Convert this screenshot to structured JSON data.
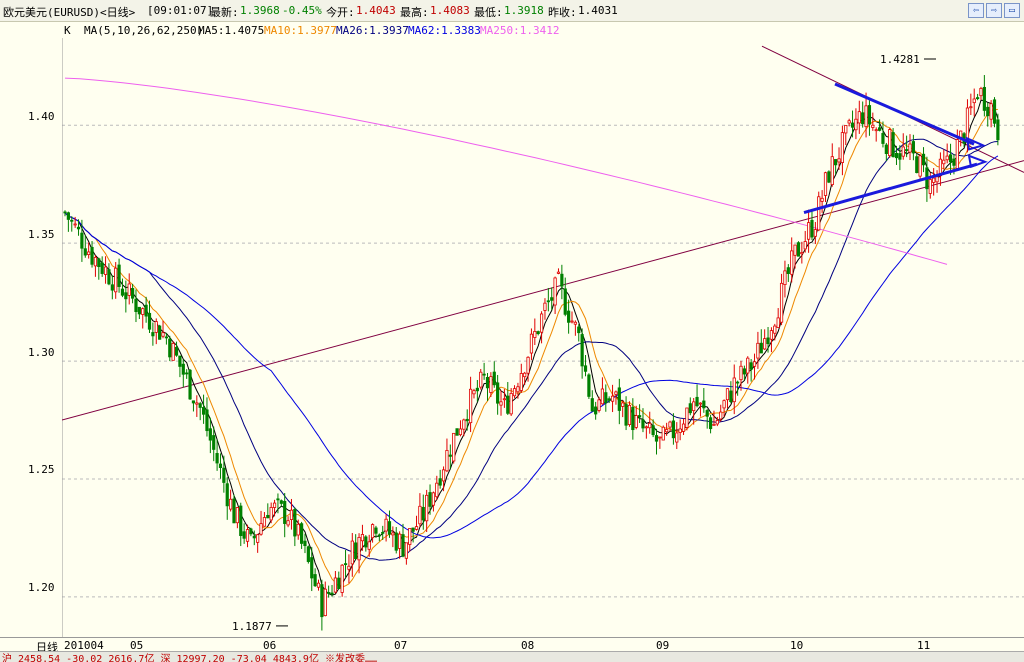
{
  "titlebar": {
    "instrument": "欧元美元(EURUSD)<日线>",
    "time": "[09:01:07]",
    "latest_label": "最新:",
    "latest": "1.3968",
    "change": "-0.45%",
    "open_label": "今开:",
    "open": "1.4043",
    "high_label": "最高:",
    "high": "1.4083",
    "low_label": "最低:",
    "low": "1.3918",
    "prev_label": "昨收:",
    "prev": "1.4031"
  },
  "ma_legend": {
    "k": "K",
    "params": "MA(5,10,26,62,250)",
    "ma5": "MA5:1.4075",
    "ma10": "MA10:1.3977",
    "ma26": "MA26:1.3937",
    "ma62": "MA62:1.3383",
    "ma250": "MA250:1.3412"
  },
  "colors": {
    "up": "#e00000",
    "down": "#008000",
    "ma5": "#000000",
    "ma10": "#ee8800",
    "ma26": "#000080",
    "ma62": "#0000e0",
    "ma250": "#ee60ee",
    "trend": "#800040",
    "arrow": "#1a1adc"
  },
  "x_axis": {
    "period": "日线",
    "labels": [
      "201004",
      "05",
      "06",
      "07",
      "08",
      "09",
      "10",
      "11"
    ]
  },
  "statusbar": {
    "text": "沪 2458.54  -30.02 2616.7亿  深 12997.20  -73.04 4843.9亿  ※发改委……"
  },
  "chart_data": {
    "type": "candlestick",
    "y_ticks": [
      "1.20",
      "1.25",
      "1.30",
      "1.35",
      "1.40"
    ],
    "ylim": [
      1.183,
      1.437
    ],
    "annotations": [
      {
        "label": "1.4281"
      },
      {
        "label": "1.1877"
      }
    ],
    "grid": true
  }
}
